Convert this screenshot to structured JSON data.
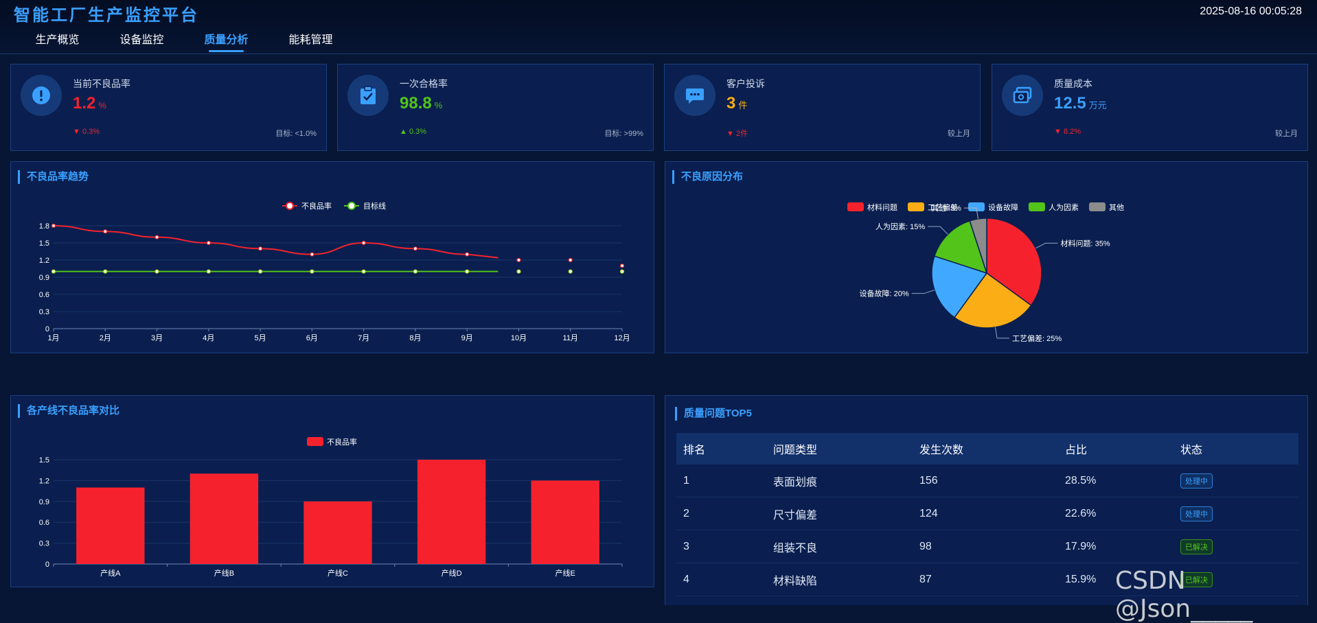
{
  "app": {
    "title": "智能工厂生产监控平台",
    "datetime": "2025-08-16 00:05:28"
  },
  "nav": {
    "tabs": [
      {
        "label": "生产概览",
        "active": false
      },
      {
        "label": "设备监控",
        "active": false
      },
      {
        "label": "质量分析",
        "active": true
      },
      {
        "label": "能耗管理",
        "active": false
      }
    ]
  },
  "kpis": [
    {
      "icon": "exclamation-icon",
      "label": "当前不良品率",
      "value": "1.2",
      "unit": "%",
      "value_color": "#f5222d",
      "change": "0.3%",
      "change_dir": "down",
      "change_color": "#f5222d",
      "note": "目标: <1.0%"
    },
    {
      "icon": "clipboard-check-icon",
      "label": "一次合格率",
      "value": "98.8",
      "unit": "%",
      "value_color": "#52c41a",
      "change": "0.3%",
      "change_dir": "up",
      "change_color": "#52c41a",
      "note": "目标: >99%"
    },
    {
      "icon": "chat-bubble-icon",
      "label": "客户投诉",
      "value": "3",
      "unit": "件",
      "value_color": "#faad14",
      "change": "2件",
      "change_dir": "down",
      "change_color": "#f5222d",
      "note": "较上月"
    },
    {
      "icon": "money-icon",
      "label": "质量成本",
      "value": "12.5",
      "unit": "万元",
      "value_color": "#3aa0ff",
      "change": "8.2%",
      "change_dir": "down",
      "change_color": "#f5222d",
      "note": "较上月"
    }
  ],
  "trend_panel": {
    "title": "不良品率趋势"
  },
  "reason_panel": {
    "title": "不良原因分布"
  },
  "line_panel": {
    "title": "各产线不良品率对比"
  },
  "top_panel": {
    "title": "质量问题TOP5",
    "columns": [
      "排名",
      "问题类型",
      "发生次数",
      "占比",
      "状态"
    ],
    "rows": [
      {
        "rank": "1",
        "type": "表面划痕",
        "count": "156",
        "ratio": "28.5%",
        "status": "处理中",
        "status_kind": "proc"
      },
      {
        "rank": "2",
        "type": "尺寸偏差",
        "count": "124",
        "ratio": "22.6%",
        "status": "处理中",
        "status_kind": "proc"
      },
      {
        "rank": "3",
        "type": "组装不良",
        "count": "98",
        "ratio": "17.9%",
        "status": "已解决",
        "status_kind": "done"
      },
      {
        "rank": "4",
        "type": "材料缺陷",
        "count": "87",
        "ratio": "15.9%",
        "status": "已解决",
        "status_kind": "done"
      }
    ]
  },
  "watermark": "CSDN @Json_____",
  "chart_data": [
    {
      "type": "line",
      "categories": [
        "1月",
        "2月",
        "3月",
        "4月",
        "5月",
        "6月",
        "7月",
        "8月",
        "9月",
        "10月",
        "11月",
        "12月"
      ],
      "series": [
        {
          "name": "不良品率",
          "color": "#f5222d",
          "values": [
            1.8,
            1.7,
            1.6,
            1.5,
            1.4,
            1.3,
            1.5,
            1.4,
            1.3,
            1.2,
            1.2,
            1.1
          ]
        },
        {
          "name": "目标线",
          "color": "#52c41a",
          "values": [
            1.0,
            1.0,
            1.0,
            1.0,
            1.0,
            1.0,
            1.0,
            1.0,
            1.0,
            1.0,
            1.0,
            1.0
          ]
        }
      ],
      "ylim": [
        0,
        1.8
      ],
      "yticks": [
        "0",
        "0.3",
        "0.6",
        "0.9",
        "1.2",
        "1.5",
        "1.8"
      ],
      "legend": "top-center",
      "grid": true
    },
    {
      "type": "pie",
      "slices": [
        {
          "name": "材料问题",
          "value": 35,
          "color": "#f5222d",
          "label": "材料问题: 35%"
        },
        {
          "name": "工艺偏差",
          "value": 25,
          "color": "#faad14",
          "label": "工艺偏差: 25%"
        },
        {
          "name": "设备故障",
          "value": 20,
          "color": "#40a9ff",
          "label": "设备故障: 20%"
        },
        {
          "name": "人为因素",
          "value": 15,
          "color": "#52c41a",
          "label": "人为因素: 15%"
        },
        {
          "name": "其他",
          "value": 5,
          "color": "#8c8c8c",
          "label": "其他: 5%"
        }
      ],
      "legend": "top-center"
    },
    {
      "type": "bar",
      "categories": [
        "产线A",
        "产线B",
        "产线C",
        "产线D",
        "产线E"
      ],
      "series": [
        {
          "name": "不良品率",
          "color": "#f5222d",
          "values": [
            1.1,
            1.3,
            0.9,
            1.5,
            1.2
          ]
        }
      ],
      "ylim": [
        0,
        1.5
      ],
      "yticks": [
        "0",
        "0.3",
        "0.6",
        "0.9",
        "1.2",
        "1.5"
      ],
      "legend": "top-center",
      "grid": true
    }
  ]
}
